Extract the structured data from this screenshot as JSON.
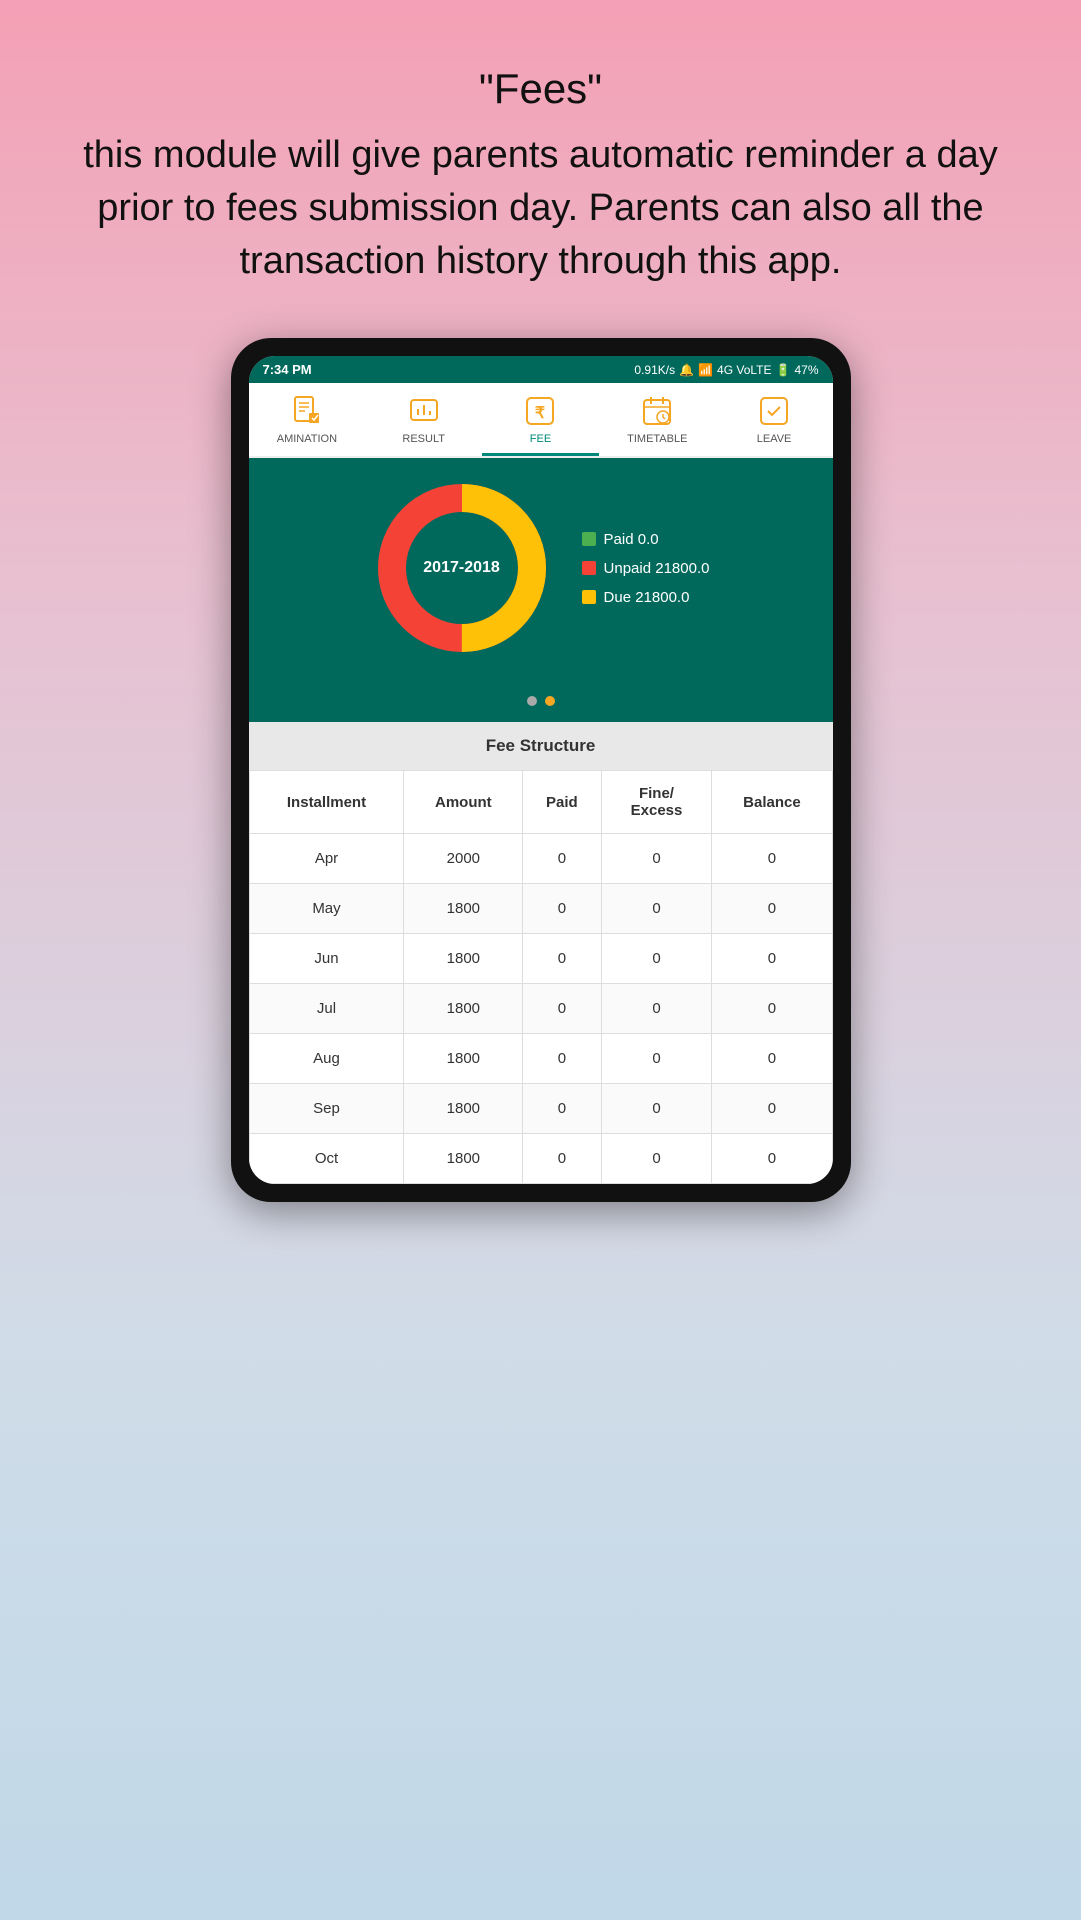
{
  "header": {
    "title": "\"Fees\"",
    "description": "this module will give parents automatic reminder a day prior to fees submission day. Parents can also all the transaction history through this app."
  },
  "status_bar": {
    "time": "7:34 PM",
    "network_speed": "0.91K/s",
    "network_type": "4G VoLTE",
    "battery": "47%"
  },
  "nav_tabs": [
    {
      "id": "examination",
      "label": "AMINATION",
      "active": false
    },
    {
      "id": "result",
      "label": "RESULT",
      "active": false
    },
    {
      "id": "fee",
      "label": "FEE",
      "active": true
    },
    {
      "id": "timetable",
      "label": "TIMETABLE",
      "active": false
    },
    {
      "id": "leave",
      "label": "LEAVE",
      "active": false
    }
  ],
  "chart": {
    "year_label": "2017-2018",
    "legend": [
      {
        "label": "Paid 0.0",
        "color": "#4caf50"
      },
      {
        "label": "Unpaid 21800.0",
        "color": "#f44336"
      },
      {
        "label": "Due 21800.0",
        "color": "#ffc107"
      }
    ],
    "donut": {
      "paid_pct": 0,
      "unpaid_pct": 50,
      "due_pct": 50
    }
  },
  "fee_structure": {
    "title": "Fee Structure",
    "columns": [
      "Installment",
      "Amount",
      "Paid",
      "Fine/\nExcess",
      "Balance"
    ],
    "rows": [
      {
        "installment": "Apr",
        "amount": "2000",
        "paid": "0",
        "fine_excess": "0",
        "balance": "0"
      },
      {
        "installment": "May",
        "amount": "1800",
        "paid": "0",
        "fine_excess": "0",
        "balance": "0"
      },
      {
        "installment": "Jun",
        "amount": "1800",
        "paid": "0",
        "fine_excess": "0",
        "balance": "0"
      },
      {
        "installment": "Jul",
        "amount": "1800",
        "paid": "0",
        "fine_excess": "0",
        "balance": "0"
      },
      {
        "installment": "Aug",
        "amount": "1800",
        "paid": "0",
        "fine_excess": "0",
        "balance": "0"
      },
      {
        "installment": "Sep",
        "amount": "1800",
        "paid": "0",
        "fine_excess": "0",
        "balance": "0"
      },
      {
        "installment": "Oct",
        "amount": "1800",
        "paid": "0",
        "fine_excess": "0",
        "balance": "0"
      }
    ]
  }
}
